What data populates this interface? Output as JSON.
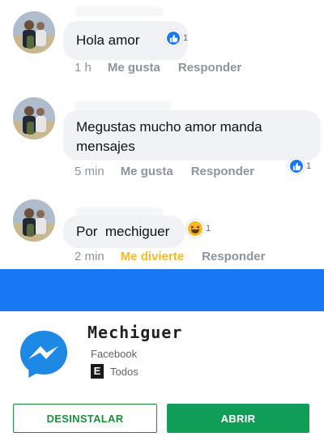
{
  "comments": [
    {
      "text": "Hola amor",
      "time": "1 h",
      "like_label": "Me gusta",
      "reply_label": "Responder",
      "reaction": {
        "icon": "thumbs-up-icon",
        "count": "1"
      }
    },
    {
      "text": "Megustas mucho amor manda mensajes",
      "text_line1": "Megustas mucho amor manda",
      "text_line2": "mensajes",
      "time": "5 min",
      "like_label": "Me gusta",
      "reply_label": "Responder",
      "reaction": {
        "icon": "thumbs-up-icon",
        "count": "1"
      }
    },
    {
      "text": "Por  mechiguer",
      "time": "2 min",
      "like_label": "Me divierte",
      "reply_label": "Responder",
      "reaction": {
        "icon": "laughing-emoji-icon",
        "count": "1"
      }
    }
  ],
  "app": {
    "name": "Mechiguer",
    "developer": "Facebook",
    "content_rating_badge": "E",
    "content_rating": "Todos",
    "icon": "messenger-icon",
    "uninstall_label": "DESINSTALAR",
    "open_label": "ABRIR"
  },
  "colors": {
    "facebook_blue": "#1877f2",
    "haha_yellow": "#f7b928",
    "play_green": "#0f9d58",
    "meta_gray": "#8d949e"
  }
}
